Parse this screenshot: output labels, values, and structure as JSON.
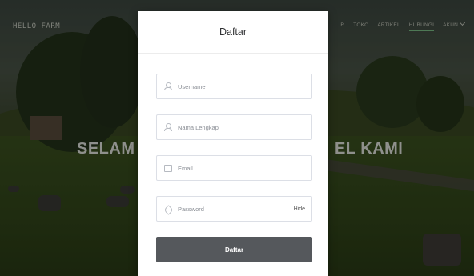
{
  "site": {
    "logo": "HELLO FARM",
    "nav": [
      {
        "label": "R",
        "active": false
      },
      {
        "label": "TOKO",
        "active": false
      },
      {
        "label": "ARTIKEL",
        "active": false
      },
      {
        "label": "HUBUNGI",
        "active": true
      },
      {
        "label": "AKUN",
        "active": false,
        "dropdown": true
      }
    ],
    "hero_left": "SELAM",
    "hero_right": "EL KAMI"
  },
  "modal": {
    "title": "Daftar",
    "fields": {
      "username": {
        "placeholder": "Username",
        "icon": "user-icon"
      },
      "fullname": {
        "placeholder": "Nama Lengkap",
        "icon": "user-icon"
      },
      "email": {
        "placeholder": "Email",
        "icon": "mail-icon"
      },
      "password": {
        "placeholder": "Password",
        "icon": "lock-icon",
        "toggle_label": "Hide"
      }
    },
    "submit_label": "Daftar"
  },
  "colors": {
    "submit_bg": "#55585c",
    "nav_active_underline": "#7fc48a"
  }
}
